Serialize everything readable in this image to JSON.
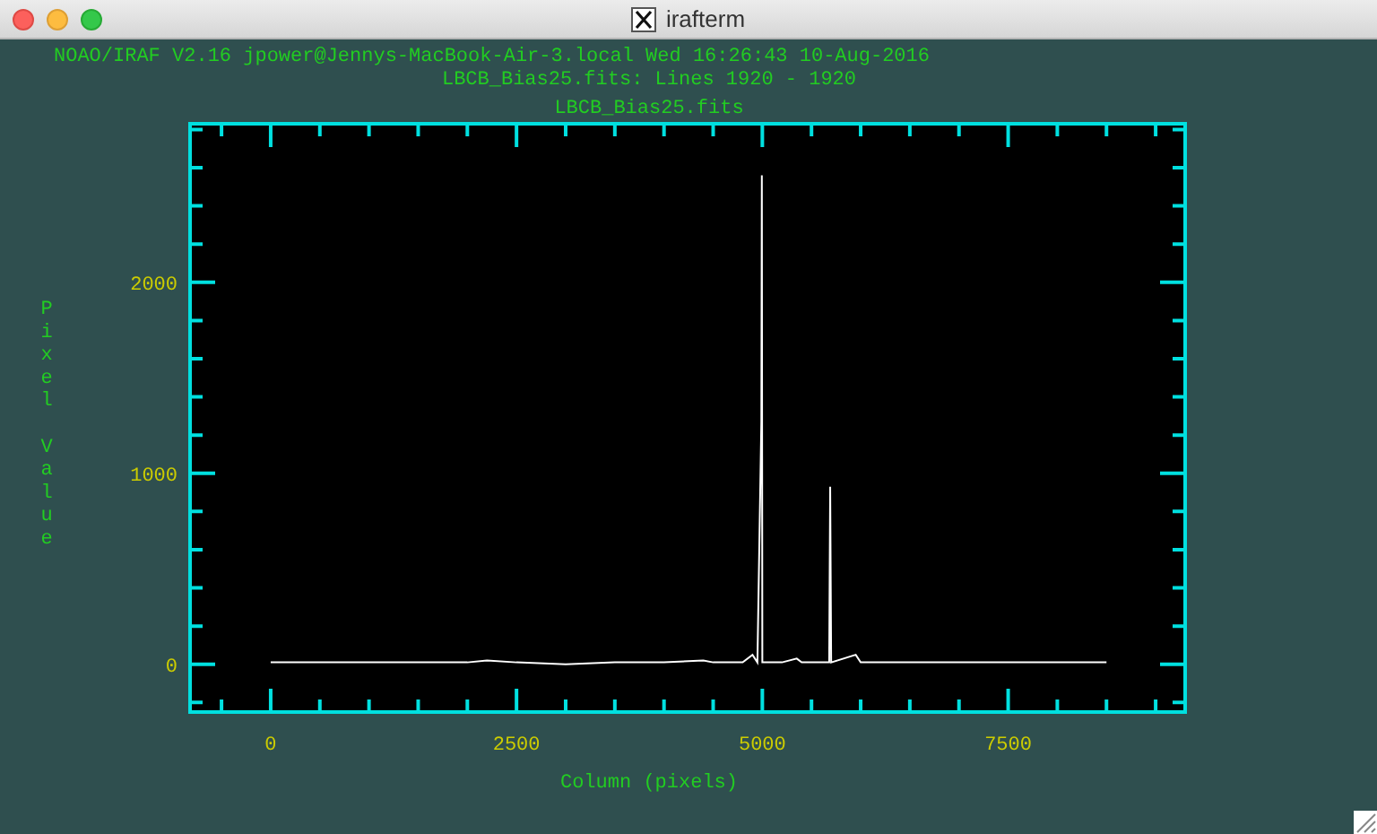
{
  "window": {
    "title": "irafterm"
  },
  "header": {
    "line_1": "NOAO/IRAF V2.16 jpower@Jennys-MacBook-Air-3.local Wed 16:26:43 10-Aug-2016",
    "line_2": "LBCB_Bias25.fits: Lines 1920 - 1920"
  },
  "chart_data": {
    "type": "line",
    "title": "LBCB_Bias25.fits",
    "xlabel": "Column (pixels)",
    "ylabel": "Pixel Value",
    "xlim": [
      -820,
      9300
    ],
    "ylim": [
      -250,
      2830
    ],
    "xticks": [
      0,
      2500,
      5000,
      7500
    ],
    "yticks": [
      0,
      1000,
      2000
    ],
    "x": [
      0,
      500,
      1000,
      1500,
      2000,
      2200,
      2500,
      3000,
      3500,
      4000,
      4400,
      4500,
      4800,
      4900,
      4950,
      4990,
      4995,
      5000,
      5200,
      5350,
      5400,
      5680,
      5690,
      5700,
      5950,
      6000,
      6500,
      7000,
      7500,
      8000,
      8500
    ],
    "series": [
      {
        "color": "#ffffff",
        "values": [
          10,
          10,
          10,
          10,
          10,
          20,
          10,
          0,
          10,
          10,
          20,
          10,
          10,
          50,
          10,
          1270,
          2560,
          10,
          10,
          30,
          10,
          10,
          930,
          10,
          50,
          10,
          10,
          10,
          10,
          10,
          10
        ]
      }
    ]
  }
}
